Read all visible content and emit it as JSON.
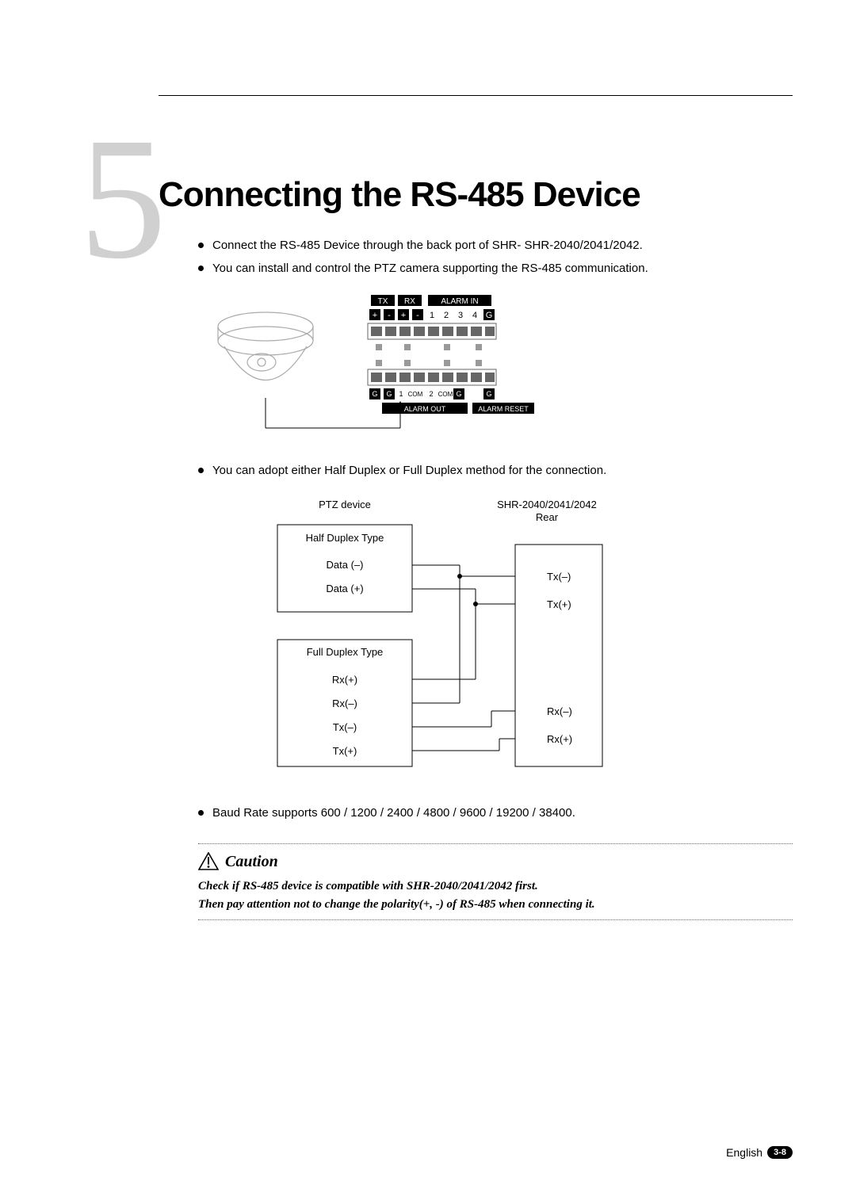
{
  "chapter": {
    "number": "5",
    "title": "Connecting the RS-485 Device"
  },
  "bullets": {
    "b1": "Connect the RS-485 Device through the back port of SHR- SHR-2040/2041/2042.",
    "b2": "You can install and control the PTZ camera supporting the RS-485 communication.",
    "b3": "You can adopt either Half Duplex or Full Duplex method for the connection.",
    "b4": "Baud Rate supports 600 / 1200 / 2400 / 4800 / 9600 / 19200 / 38400."
  },
  "terminal": {
    "labels": {
      "tx": "TX",
      "rx": "RX",
      "alarm_in": "ALARM IN",
      "alarm_out": "ALARM OUT",
      "alarm_reset": "ALARM RESET"
    },
    "top_row": [
      "+",
      "-",
      "+",
      "-",
      "1",
      "2",
      "3",
      "4",
      "G"
    ],
    "bottom_row": [
      "G",
      "G",
      "1",
      "COM",
      "2",
      "COM",
      "G",
      "",
      "G"
    ]
  },
  "wiring": {
    "left_header": "PTZ device",
    "right_header": "SHR-2040/2041/2042",
    "right_header_sub": "Rear",
    "half_duplex_title": "Half Duplex Type",
    "full_duplex_title": "Full Duplex Type",
    "half": {
      "a": "Data (–)",
      "b": "Data (+)"
    },
    "full": {
      "rxp": "Rx(+)",
      "rxn": "Rx(–)",
      "txn": "Tx(–)",
      "txp": "Tx(+)"
    },
    "right": {
      "txn": "Tx(–)",
      "txp": "Tx(+)",
      "rxn": "Rx(–)",
      "rxp": "Rx(+)"
    }
  },
  "caution": {
    "label": "Caution",
    "line1": "Check if RS-485 device is compatible with SHR-2040/2041/2042 first.",
    "line2": "Then pay attention not to change the polarity(+, -) of RS-485 when connecting it."
  },
  "footer": {
    "lang": "English",
    "page": "3-8"
  }
}
